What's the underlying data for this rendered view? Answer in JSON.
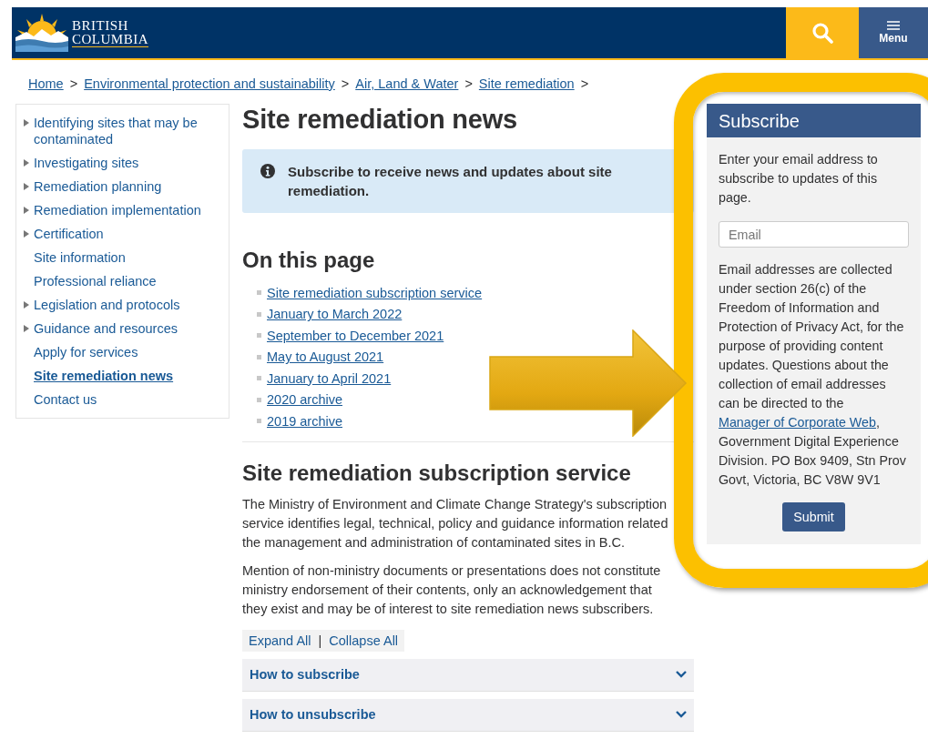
{
  "header": {
    "logo_lines": [
      "BRITISH",
      "COLUMBIA"
    ],
    "menu_label": "Menu"
  },
  "breadcrumb": [
    {
      "label": "Home",
      "separator": ">"
    },
    {
      "label": "Environmental protection and sustainability",
      "separator": ">"
    },
    {
      "label": "Air, Land & Water",
      "separator": ">"
    },
    {
      "label": "Site remediation",
      "separator": ">"
    }
  ],
  "side_nav": [
    {
      "label": "Identifying sites that may be contaminated",
      "expandable": true,
      "selected": false
    },
    {
      "label": "Investigating sites",
      "expandable": true,
      "selected": false
    },
    {
      "label": "Remediation planning",
      "expandable": true,
      "selected": false
    },
    {
      "label": "Remediation implementation",
      "expandable": true,
      "selected": false
    },
    {
      "label": "Certification",
      "expandable": true,
      "selected": false
    },
    {
      "label": "Site information",
      "expandable": false,
      "selected": false
    },
    {
      "label": "Professional reliance",
      "expandable": false,
      "selected": false
    },
    {
      "label": "Legislation and protocols",
      "expandable": true,
      "selected": false
    },
    {
      "label": "Guidance and resources",
      "expandable": true,
      "selected": false
    },
    {
      "label": "Apply for services",
      "expandable": false,
      "selected": false
    },
    {
      "label": "Site remediation news",
      "expandable": false,
      "selected": true
    },
    {
      "label": "Contact us",
      "expandable": false,
      "selected": false
    }
  ],
  "main": {
    "title": "Site remediation news",
    "alert": "Subscribe to receive news and updates about site remediation.",
    "on_this_page": {
      "heading": "On this page",
      "links": [
        "Site remediation subscription service",
        "January to March 2022",
        "September to December 2021",
        "May to August 2021",
        "January to April 2021",
        "2020 archive",
        "2019 archive"
      ]
    },
    "section": {
      "heading": "Site remediation subscription service",
      "paragraphs": [
        "The Ministry of Environment and Climate Change Strategy's subscription service identifies legal, technical, policy and guidance information related the management and administration of contaminated sites in B.C.",
        "Mention of non-ministry documents or presentations does not constitute ministry endorsement of their contents, only an acknowledgement that they exist and may be of interest to site remediation news subscribers."
      ],
      "expand_all": "Expand All",
      "toggle_separator": "|",
      "collapse_all": "Collapse All",
      "accordion": [
        {
          "label": "How to subscribe",
          "expanded": false
        },
        {
          "label": "How to unsubscribe",
          "expanded": false
        }
      ]
    }
  },
  "subscribe": {
    "title": "Subscribe",
    "intro": "Enter your email address to subscribe to updates of this page.",
    "email": {
      "placeholder": "Email"
    },
    "notice_before": "Email addresses are collected under section 26(c) of the Freedom of Information and Protection of Privacy Act, for the purpose of providing content updates. Questions about the collection of email addresses can be directed to the",
    "notice_link": "Manager of Corporate Web",
    "notice_after": ", Government Digital Experience Division. PO Box 9409, Stn Prov Govt, Victoria, BC V8W 9V1",
    "submit": "Submit"
  }
}
